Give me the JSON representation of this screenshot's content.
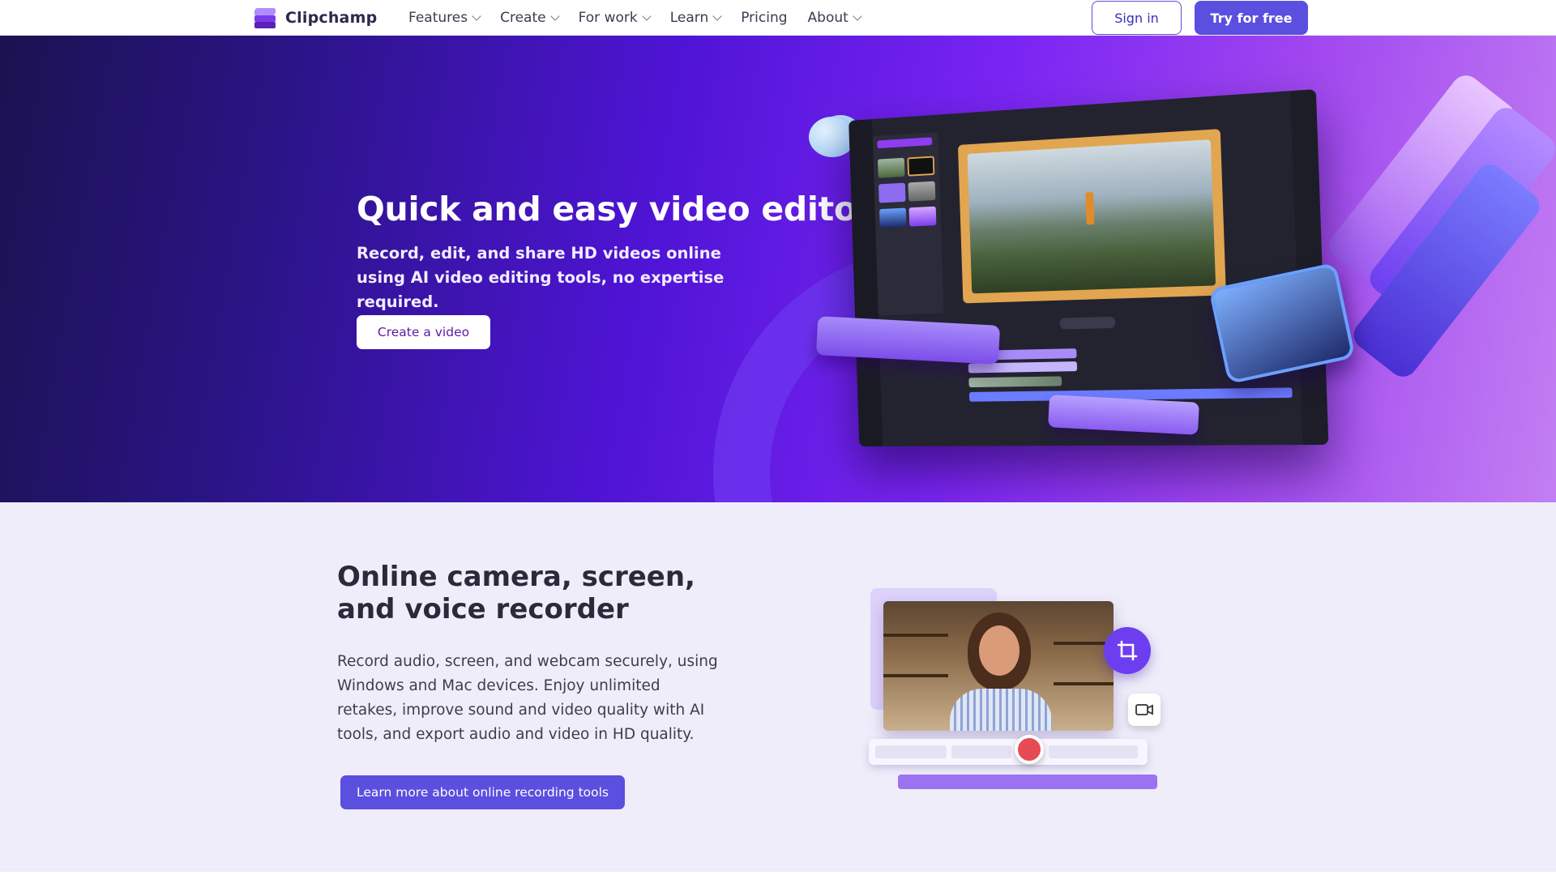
{
  "brand": {
    "name": "Clipchamp"
  },
  "nav": {
    "items": [
      {
        "label": "Features",
        "has_dropdown": true
      },
      {
        "label": "Create",
        "has_dropdown": true
      },
      {
        "label": "For work",
        "has_dropdown": true
      },
      {
        "label": "Learn",
        "has_dropdown": true
      },
      {
        "label": "Pricing",
        "has_dropdown": false
      },
      {
        "label": "About",
        "has_dropdown": true
      }
    ],
    "sign_in": "Sign in",
    "try_free": "Try for free"
  },
  "hero": {
    "title": "Quick and easy video editor",
    "subtitle": "Record, edit, and share HD videos online using AI video editing tools, no expertise required.",
    "cta": "Create a video"
  },
  "recorder_section": {
    "title": "Online camera, screen, and voice recorder",
    "body": "Record audio, screen, and webcam securely, using Windows and Mac devices. Enjoy unlimited retakes, improve sound and video quality with AI tools, and export audio and video in HD quality.",
    "cta": "Learn more about online recording tools"
  },
  "colors": {
    "accent": "#5b4fe0",
    "hero_gradient_start": "#1b1250",
    "hero_gradient_end": "#c27ff2",
    "section_bg": "#efedfa",
    "record_red": "#e64b55"
  },
  "icons": [
    "clipchamp-logo-icon",
    "chevron-down-icon",
    "crop-icon",
    "camera-icon",
    "record-icon"
  ]
}
